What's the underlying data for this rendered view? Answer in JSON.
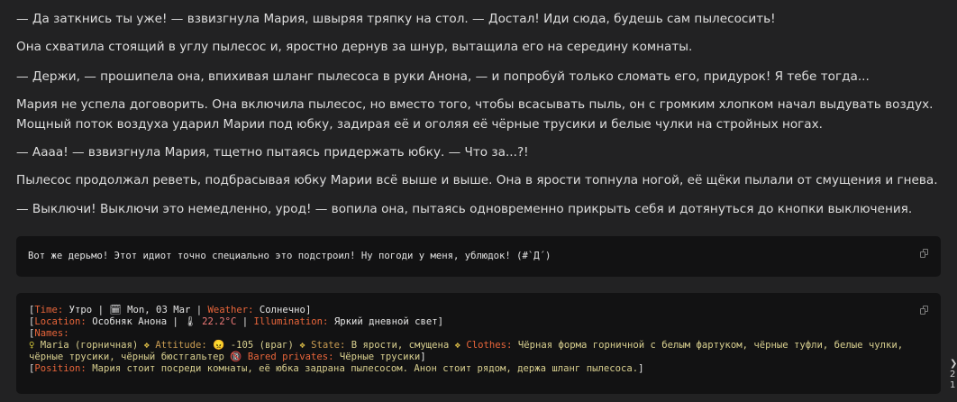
{
  "messages": [
    "— Да заткнись ты уже! — взвизгнула Мария, швыряя тряпку на стол. — Достал! Иди сюда, будешь сам пылесосить!",
    "Она схватила стоящий в углу пылесос и, яростно дернув за шнур, вытащила его на середину комнаты.",
    "— Держи, — прошипела она, впихивая шланг пылесоса в руки Анона, — и попробуй только сломать его, придурок! Я тебе тогда...",
    "Мария не успела договорить. Она включила пылесос, но вместо того, чтобы всасывать пыль, он с громким хлопком начал выдувать воздух. Мощный поток воздуха ударил Марии под юбку, задирая её и оголяя её чёрные трусики и белые чулки на стройных ногах.",
    "— Аааа! — взвизгнула Мария, тщетно пытаясь придержать юбку. — Что за...?!",
    "Пылесос продолжал реветь, подбрасывая юбку Марии всё выше и выше. Она в ярости топнула ногой, её щёки пылали от смущения и гнева.",
    "— Выключи! Выключи это немедленно, урод! — вопила она, пытаясь одновременно прикрыть себя и дотянуться до кнопки выключения."
  ],
  "code_block_1": {
    "text": "Вот же дерьмо! Этот идиот точно специально это подстроил! Ну погоди у меня, ублюдок! (#`Д´)"
  },
  "status": {
    "time_label": "Time:",
    "time_value": "Утро",
    "calendar_icon": "🗓",
    "date": "Mon, 03 Mar",
    "weather_label": "Weather:",
    "weather_value": "Солнечно",
    "location_label": "Location:",
    "location_value": "Особняк Анона",
    "thermometer_icon": "🌡",
    "temperature": "22.2°C",
    "illumination_label": "Illumination:",
    "illumination_value": "Яркий дневной свет",
    "names_label": "Names:",
    "female_icon": "♀",
    "character": "Maria (горничная)",
    "sep_icon": "❖",
    "attitude_label": "Attitude:",
    "attitude_icon": "😠",
    "attitude_value": "-105 (враг)",
    "state_label": "State:",
    "state_value": "В ярости, смущена",
    "clothes_label": "Clothes:",
    "clothes_value": "Чёрная форма горничной с белым фартуком, чёрные туфли, белые чулки, чёрные трусики, чёрный бюстгальтер",
    "adult_icon": "🔞",
    "bared_label": "Bared privates:",
    "bared_value": "Чёрные трусики",
    "position_label": "Position:",
    "position_value": "Мария стоит посреди комнаты, её юбка задрана пылесосом. Анон стоит рядом, держа шланг пылесоса."
  }
}
